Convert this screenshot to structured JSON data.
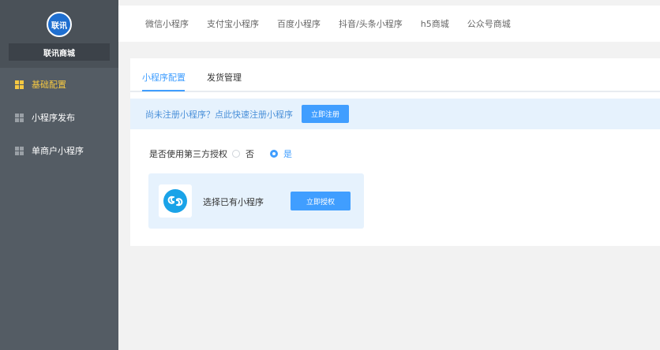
{
  "sidebar": {
    "logo_text": "联讯",
    "brand": "联讯商城",
    "items": [
      {
        "label": "基础配置",
        "active": true
      },
      {
        "label": "小程序发布",
        "active": false
      },
      {
        "label": "单商户小程序",
        "active": false
      }
    ]
  },
  "topnav": {
    "tabs": [
      "微信小程序",
      "支付宝小程序",
      "百度小程序",
      "抖音/头条小程序",
      "h5商城",
      "公众号商城"
    ]
  },
  "subtabs": [
    {
      "label": "小程序配置",
      "active": true
    },
    {
      "label": "发货管理",
      "active": false
    }
  ],
  "notice": {
    "text": "尚未注册小程序？点此快速注册小程序",
    "button": "立即注册"
  },
  "auth": {
    "label": "是否使用第三方授权",
    "options": [
      {
        "label": "否",
        "checked": false
      },
      {
        "label": "是",
        "checked": true
      }
    ]
  },
  "miniprogram": {
    "text": "选择已有小程序",
    "button": "立即授权",
    "icon": "mini-program-icon"
  },
  "colors": {
    "accent": "#409eff",
    "active_sidebar": "#f5c842",
    "sidebar_bg": "#545c64"
  }
}
